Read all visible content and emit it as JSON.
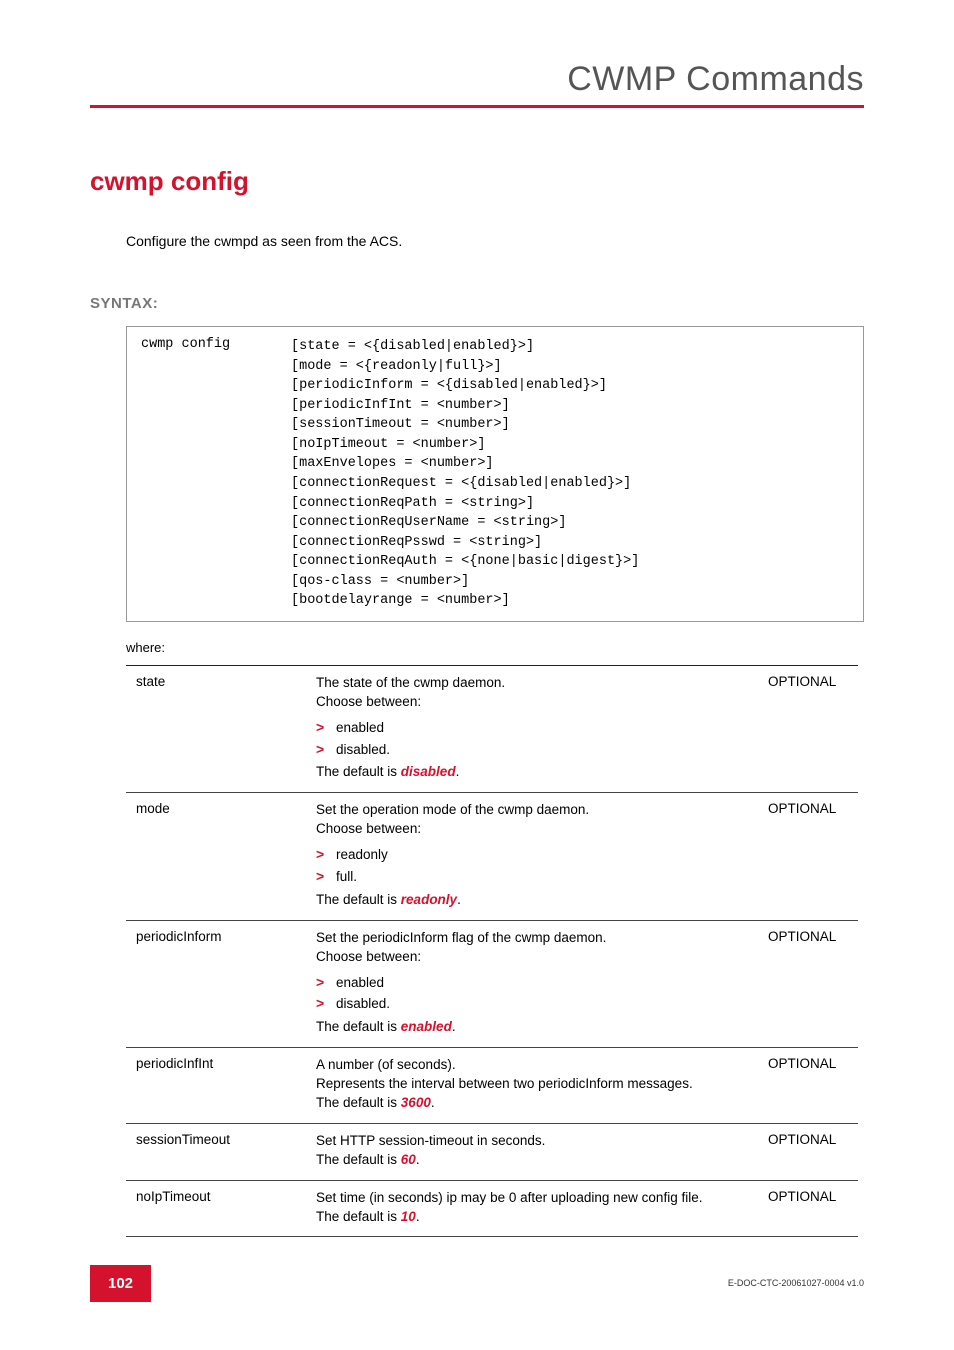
{
  "header": {
    "title": "CWMP Commands"
  },
  "command": {
    "title": "cwmp config",
    "description": "Configure the cwmpd as seen from the ACS."
  },
  "section": {
    "syntax_label": "SYNTAX:",
    "where_label": "where:"
  },
  "syntax": {
    "cmd": "cwmp config",
    "args": "[state = <{disabled|enabled}>]\n[mode = <{readonly|full}>]\n[periodicInform = <{disabled|enabled}>]\n[periodicInfInt = <number>]\n[sessionTimeout = <number>]\n[noIpTimeout = <number>]\n[maxEnvelopes = <number>]\n[connectionRequest = <{disabled|enabled}>]\n[connectionReqPath = <string>]\n[connectionReqUserName = <string>]\n[connectionReqPsswd = <string>]\n[connectionReqAuth = <{none|basic|digest}>]\n[qos-class = <number>]\n[bootdelayrange = <number>]"
  },
  "params": [
    {
      "name": "state",
      "intro": "The state of the cwmp daemon.",
      "choose": "Choose between:",
      "options": [
        "enabled",
        "disabled."
      ],
      "default_pre": "The default is ",
      "default_val": "disabled",
      "default_post": ".",
      "req": "OPTIONAL"
    },
    {
      "name": "mode",
      "intro": "Set the operation mode of the cwmp daemon.",
      "choose": "Choose between:",
      "options": [
        "readonly",
        "full."
      ],
      "default_pre": "The default is ",
      "default_val": "readonly",
      "default_post": ".",
      "req": "OPTIONAL"
    },
    {
      "name": "periodicInform",
      "intro": "Set the periodicInform flag of the cwmp daemon.",
      "choose": "Choose between:",
      "options": [
        "enabled",
        "disabled."
      ],
      "default_pre": "The default is ",
      "default_val": "enabled",
      "default_post": ".",
      "req": "OPTIONAL"
    },
    {
      "name": "periodicInfInt",
      "intro": "A number (of seconds).",
      "extra": "Represents the interval between two periodicInform messages.",
      "default_pre": "The default is ",
      "default_val": "3600",
      "default_post": ".",
      "req": "OPTIONAL"
    },
    {
      "name": "sessionTimeout",
      "intro": "Set HTTP session-timeout in seconds.",
      "default_pre": "The default is ",
      "default_val": "60",
      "default_post": ".",
      "req": "OPTIONAL"
    },
    {
      "name": "noIpTimeout",
      "intro": "Set time (in seconds) ip may be 0 after uploading new config file.",
      "default_pre": "The default is ",
      "default_val": "10",
      "default_post": ".",
      "req": "OPTIONAL"
    }
  ],
  "footer": {
    "doc_id": "E-DOC-CTC-20061027-0004 v1.0",
    "page_number": "102"
  }
}
